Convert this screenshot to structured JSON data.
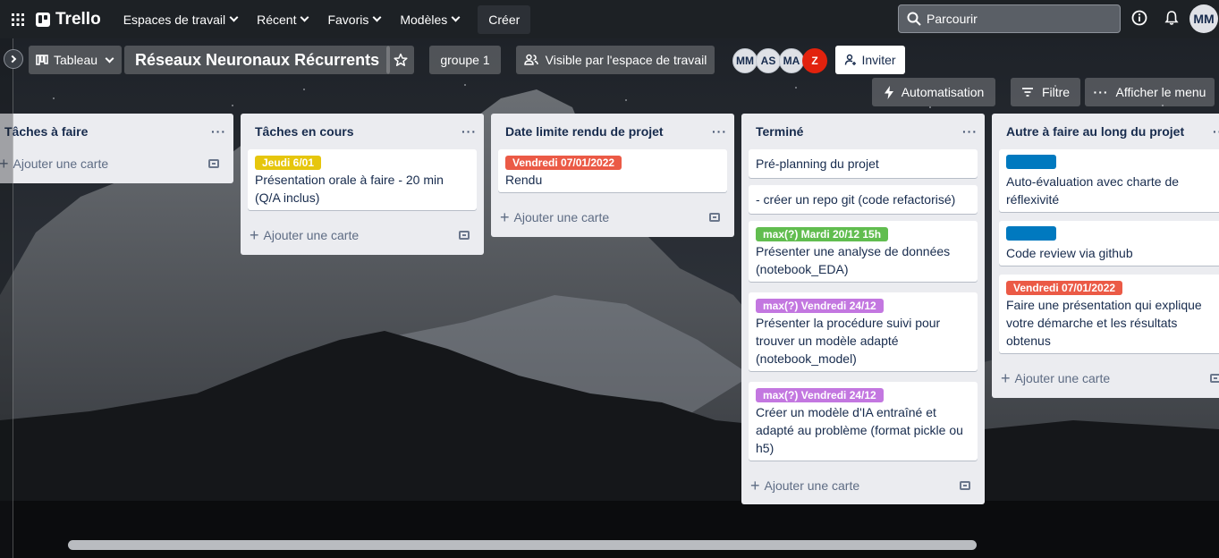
{
  "nav": {
    "logo": "Trello",
    "items": [
      "Espaces de travail",
      "Récent",
      "Favoris",
      "Modèles"
    ],
    "create": "Créer",
    "search_placeholder": "Parcourir",
    "user_initials": "MM"
  },
  "board": {
    "view_label": "Tableau",
    "title": "Réseaux Neuronaux Récurrents",
    "workspace": "groupe 1",
    "visibility": "Visible par l'espace de travail",
    "members": [
      "MM",
      "AS",
      "MA",
      "Z"
    ],
    "invite": "Inviter",
    "automation": "Automatisation",
    "filter": "Filtre",
    "menu": "Afficher le menu"
  },
  "add_card": "Ajouter une carte",
  "lists": [
    {
      "title": "Tâches à faire",
      "cards": []
    },
    {
      "title": "Tâches en cours",
      "cards": [
        {
          "label": "Jeudi 6/01",
          "label_color": "#e6c60d",
          "text": "Présentation orale à faire - 20 min (Q/A inclus)"
        }
      ]
    },
    {
      "title": "Date limite rendu de projet",
      "cards": [
        {
          "label": "Vendredi 07/01/2022",
          "label_color": "#eb5a46",
          "text": "Rendu"
        }
      ]
    },
    {
      "title": "Terminé",
      "cards": [
        {
          "text": "Pré-planning du projet"
        },
        {
          "text": "- créer un repo git (code refactorisé)"
        },
        {
          "label": "max(?) Mardi 20/12 15h",
          "label_color": "#61bd4f",
          "text": "Présenter une analyse de données (notebook_EDA)"
        },
        {
          "label": "max(?) Vendredi 24/12",
          "label_color": "#c377e0",
          "text": "Présenter la procédure suivi pour trouver un modèle adapté (notebook_model)"
        },
        {
          "label": "max(?) Vendredi 24/12",
          "label_color": "#c377e0",
          "text": "Créer un modèle d'IA entraîné et adapté au problème (format pickle ou h5)"
        }
      ]
    },
    {
      "title": "Autre à faire au long du projet",
      "cards": [
        {
          "label_color": "#0079bf",
          "text": "Auto-évaluation avec charte de réflexivité"
        },
        {
          "label_color": "#0079bf",
          "text": "Code review via github"
        },
        {
          "label": "Vendredi 07/01/2022",
          "label_color": "#eb5a46",
          "text": "Faire une présentation qui explique votre démarche et les résultats obtenus"
        }
      ]
    }
  ],
  "list_menu": "···"
}
